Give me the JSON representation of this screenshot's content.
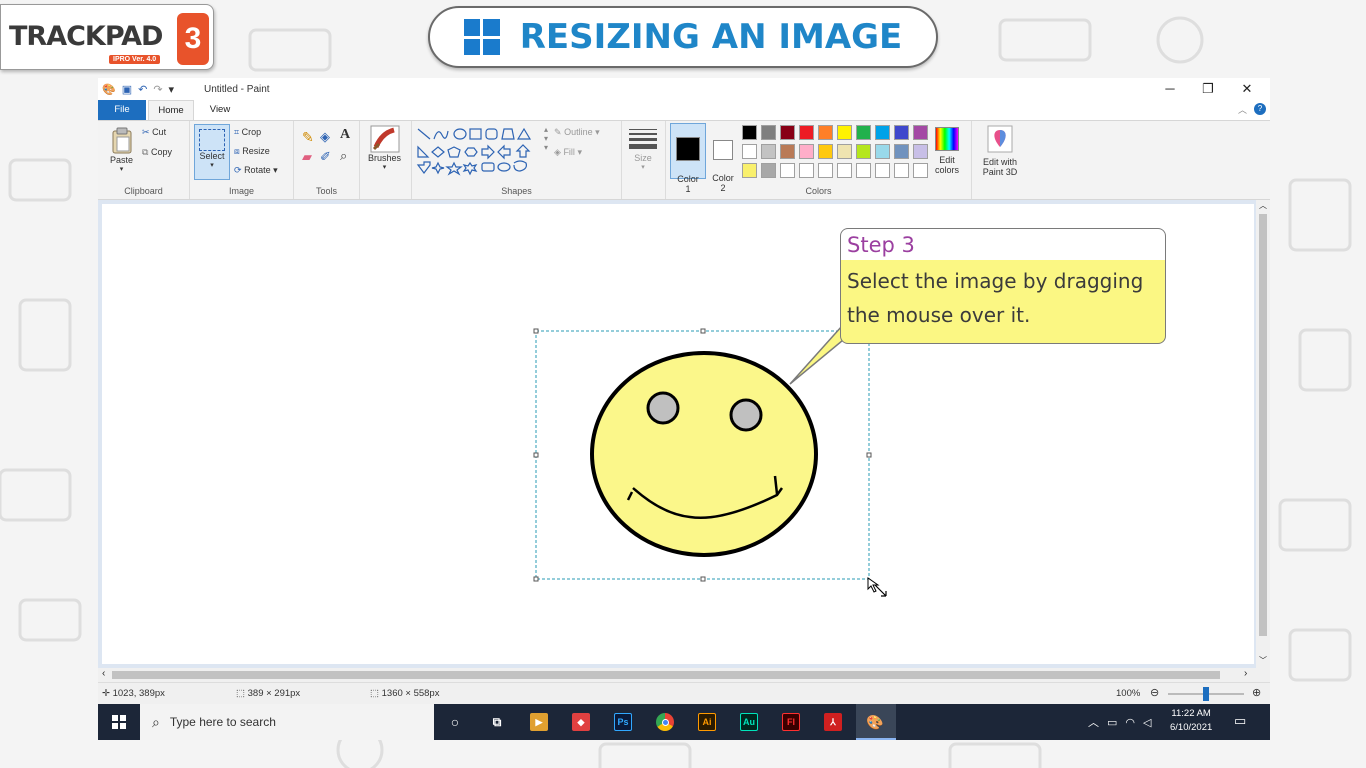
{
  "logo": {
    "brand": "TRACKPAD",
    "edition": "IPRO Ver. 4.0",
    "number": "3"
  },
  "banner": {
    "title": "RESIZING AN IMAGE",
    "icon": "windows-logo-icon"
  },
  "window": {
    "title": "Untitled - Paint",
    "tabs": [
      "File",
      "Home",
      "View"
    ],
    "controls": {
      "minimize": "─",
      "restore": "❐",
      "close": "✕"
    }
  },
  "ribbon": {
    "clipboard": {
      "label": "Clipboard",
      "paste": "Paste",
      "cut": "Cut",
      "copy": "Copy"
    },
    "image": {
      "label": "Image",
      "select": "Select",
      "crop": "Crop",
      "resize": "Resize",
      "rotate": "Rotate"
    },
    "tools": {
      "label": "Tools"
    },
    "brushes": {
      "label": "Brushes"
    },
    "shapes": {
      "label": "Shapes",
      "outline": "Outline",
      "fill": "Fill"
    },
    "size": {
      "label": "Size"
    },
    "colors": {
      "label": "Colors",
      "color1": "Color\n1",
      "color2": "Color\n2",
      "edit_colors": "Edit colors",
      "edit_paint3d": "Edit with Paint 3D",
      "color1_value": "#000000",
      "color2_value": "#ffffff",
      "palette_row1": [
        "#000000",
        "#7f7f7f",
        "#880015",
        "#ed1c24",
        "#ff7f27",
        "#fff200",
        "#22b14c",
        "#00a2e8",
        "#3f48cc",
        "#a349a4"
      ],
      "palette_row2": [
        "#ffffff",
        "#c3c3c3",
        "#b97a57",
        "#ffaec9",
        "#ffc90e",
        "#efe4b0",
        "#b5e61d",
        "#99d9ea",
        "#7092be",
        "#c8bfe7"
      ],
      "palette_row3": [
        "#f9f06d",
        "#a8a8a8",
        "#ffffff",
        "#ffffff",
        "#ffffff",
        "#ffffff",
        "#ffffff",
        "#ffffff",
        "#ffffff",
        "#ffffff"
      ]
    }
  },
  "callout": {
    "step": "Step 3",
    "text_line1": "Select the image by dragging",
    "text_line2": "the mouse over it."
  },
  "drawing": {
    "face_fill": "#fbf78a",
    "eye_fill": "#c0c0c0",
    "selection_color": "#2a9bb5"
  },
  "status": {
    "cursor_pos": "1023, 389px",
    "selection_size": "389 × 291px",
    "image_size": "1360 × 558px",
    "zoom": "100%",
    "zoom_level": 0.5
  },
  "taskbar": {
    "search_placeholder": "Type here to search",
    "apps": [
      "Ps",
      "Ai",
      "Au",
      "Fl"
    ],
    "time": "11:22 AM",
    "date": "6/10/2021"
  }
}
